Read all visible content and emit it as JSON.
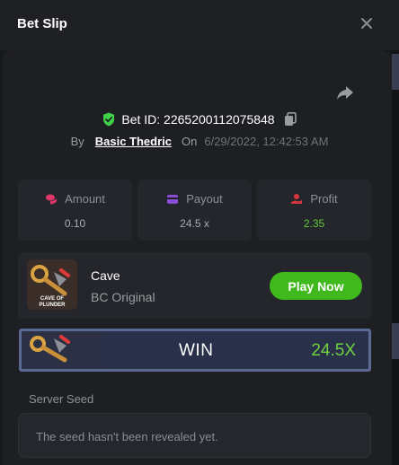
{
  "header": {
    "title": "Bet Slip",
    "close_icon": "close-icon"
  },
  "bet": {
    "id_text": "Bet ID: 2265200112075848",
    "by_label": "By",
    "user": "Basic Thedric",
    "on_label": "On",
    "date": "6/29/2022, 12:42:53 AM"
  },
  "stats": [
    {
      "label": "Amount",
      "value": "0.10",
      "icon": "coins-icon",
      "color": "#e0386a"
    },
    {
      "label": "Payout",
      "value": "24.5 x",
      "icon": "wallet-icon",
      "color": "#8a4dd8"
    },
    {
      "label": "Profit",
      "value": "2.35",
      "icon": "profit-hand-icon",
      "color": "#d8353f"
    }
  ],
  "game": {
    "name": "Cave",
    "provider": "BC Original",
    "play_label": "Play Now",
    "thumb_text_1": "CAVE OF",
    "thumb_text_2": "PLUNDER"
  },
  "result": {
    "label": "WIN",
    "multiplier": "24.5X"
  },
  "seed": {
    "label": "Server Seed",
    "placeholder": "The seed hasn't been revealed yet."
  },
  "colors": {
    "accent_green": "#3fb91c",
    "win_green": "#70d13e",
    "shield_green": "#3fd14a"
  }
}
